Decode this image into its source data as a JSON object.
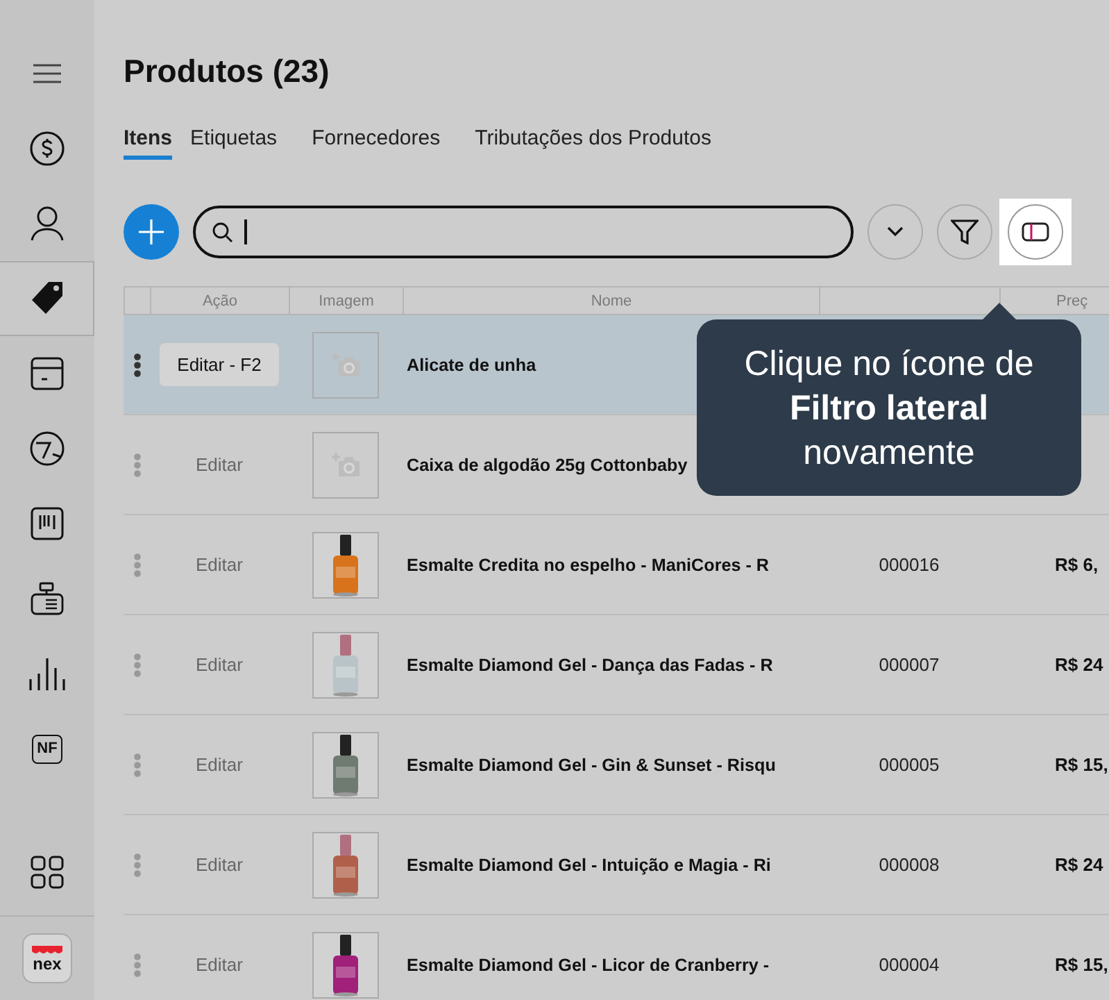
{
  "sidebar": {
    "items": [
      {
        "kind": "menu",
        "selected": false
      },
      {
        "kind": "dollar",
        "selected": false
      },
      {
        "kind": "user",
        "selected": false
      },
      {
        "kind": "tag",
        "selected": true
      },
      {
        "kind": "box",
        "selected": false
      },
      {
        "kind": "chart-pie",
        "selected": false
      },
      {
        "kind": "barcode",
        "selected": false
      },
      {
        "kind": "register",
        "selected": false
      },
      {
        "kind": "bars",
        "selected": false
      },
      {
        "kind": "nf",
        "label": "NF",
        "selected": false
      },
      {
        "kind": "grid",
        "selected": false
      }
    ],
    "logo": "nex"
  },
  "page": {
    "title": "Produtos (23)"
  },
  "tabs": [
    {
      "label": "Itens",
      "selected": true
    },
    {
      "label": "Etiquetas",
      "selected": false
    },
    {
      "label": "Fornecedores",
      "selected": false
    },
    {
      "label": "Tributações dos Produtos",
      "selected": false
    }
  ],
  "table": {
    "columns": [
      "",
      "Ação",
      "Imagem",
      "Nome",
      "",
      "Preç"
    ],
    "rows": [
      {
        "selected": true,
        "action": "Editar - F2",
        "image": {
          "kind": "placeholder"
        },
        "name": "Alicate de unha"
      },
      {
        "selected": false,
        "action": "Editar",
        "image": {
          "kind": "placeholder"
        },
        "name": "Caixa de algodão 25g Cottonbaby"
      },
      {
        "selected": false,
        "action": "Editar",
        "name": "Esmalte Credita no espelho - ManiCores - R",
        "code": "000016",
        "price": "R$ 6,"
      },
      {
        "selected": false,
        "action": "Editar",
        "name": "Esmalte Diamond Gel - Dança das Fadas - R",
        "code": "000007",
        "price": "R$ 24"
      },
      {
        "selected": false,
        "action": "Editar",
        "name": "Esmalte Diamond Gel - Gin & Sunset - Risqu",
        "code": "000005",
        "price": "R$ 15,"
      },
      {
        "selected": false,
        "action": "Editar",
        "name": "Esmalte Diamond Gel - Intuição e Magia - Ri",
        "code": "000008",
        "price": "R$ 24"
      },
      {
        "selected": false,
        "action": "Editar",
        "name": "Esmalte Diamond Gel - Licor de Cranberry -",
        "code": "000004",
        "price": "R$ 15,"
      }
    ]
  },
  "tooltip": {
    "text": "Clique no ícone de **Filtro lateral** novamente"
  }
}
